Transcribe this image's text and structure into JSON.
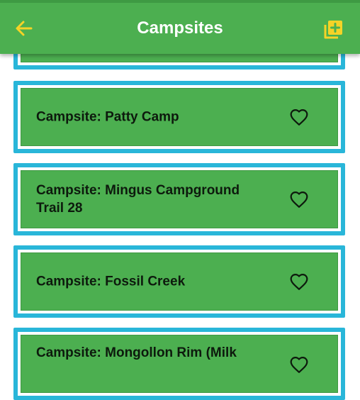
{
  "app_bar": {
    "title": "Campsites",
    "back_icon": "arrow-left-icon",
    "add_icon": "add-box-icon",
    "bar_color": "#4caf50",
    "icon_color": "#f5d327"
  },
  "campsites": [
    {
      "label": ""
    },
    {
      "label": "Campsite: Patty Camp"
    },
    {
      "label": "Campsite: Mingus Campground Trail 28"
    },
    {
      "label": "Campsite: Fossil Creek"
    },
    {
      "label": "Campsite: Mongollon Rim (Milk"
    }
  ],
  "colors": {
    "card_border": "#29b6d9",
    "card_fill": "#4caf50"
  }
}
